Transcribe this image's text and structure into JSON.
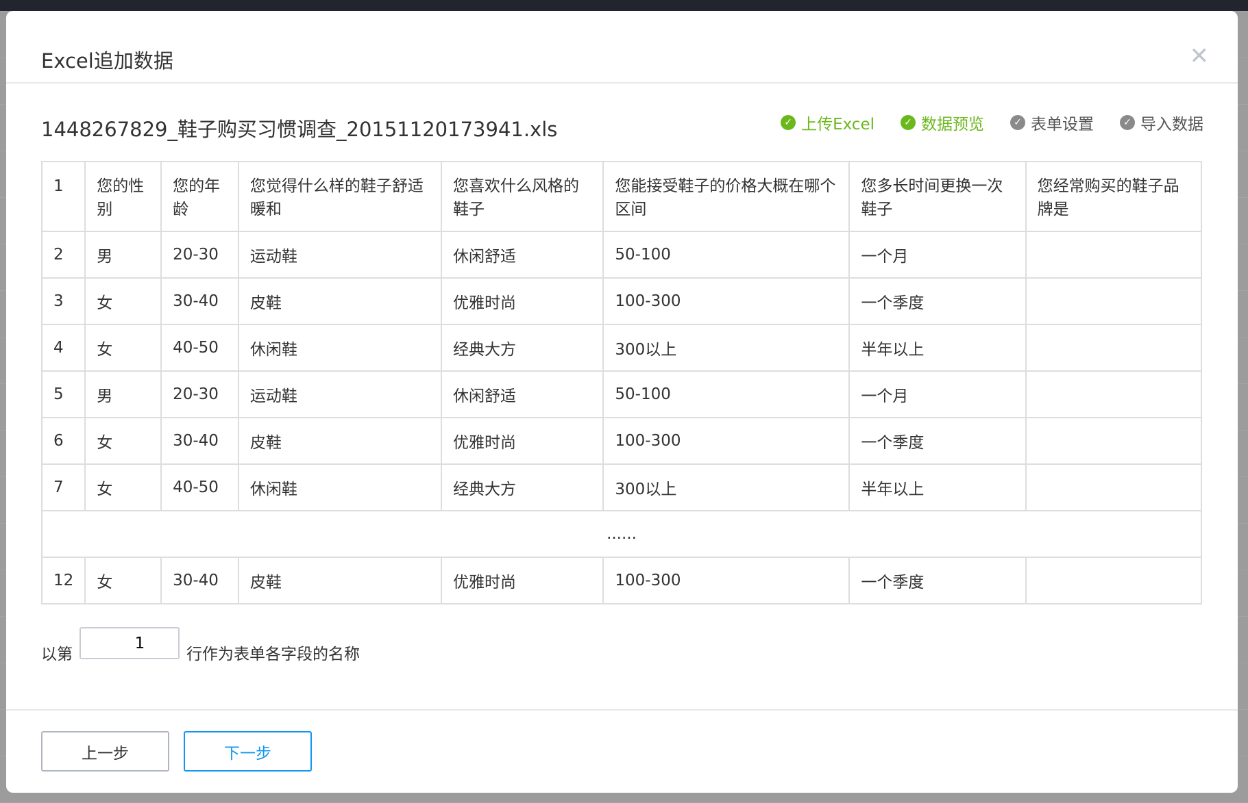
{
  "dialog": {
    "title": "Excel追加数据",
    "close_icon": "close-icon",
    "filename": "1448267829_鞋子购买习惯调查_20151120173941.xls"
  },
  "steps": [
    {
      "label": "上传Excel",
      "status": "done"
    },
    {
      "label": "数据预览",
      "status": "done"
    },
    {
      "label": "表单设置",
      "status": "pending"
    },
    {
      "label": "导入数据",
      "status": "pending"
    }
  ],
  "colors": {
    "done": "#6bb81c",
    "pending": "#8a8a8a",
    "primary": "#1296f0"
  },
  "table": {
    "header": [
      "1",
      "您的性别",
      "您的年龄",
      "您觉得什么样的鞋子舒适暖和",
      "您喜欢什么风格的鞋子",
      "您能接受鞋子的价格大概在哪个区间",
      "您多长时间更换一次鞋子",
      "您经常购买的鞋子品牌是"
    ],
    "rows": [
      [
        "2",
        "男",
        "20-30",
        "运动鞋",
        "休闲舒适",
        "50-100",
        "一个月",
        ""
      ],
      [
        "3",
        "女",
        "30-40",
        "皮鞋",
        "优雅时尚",
        "100-300",
        "一个季度",
        ""
      ],
      [
        "4",
        "女",
        "40-50",
        "休闲鞋",
        "经典大方",
        "300以上",
        "半年以上",
        ""
      ],
      [
        "5",
        "男",
        "20-30",
        "运动鞋",
        "休闲舒适",
        "50-100",
        "一个月",
        ""
      ],
      [
        "6",
        "女",
        "30-40",
        "皮鞋",
        "优雅时尚",
        "100-300",
        "一个季度",
        ""
      ],
      [
        "7",
        "女",
        "40-50",
        "休闲鞋",
        "经典大方",
        "300以上",
        "半年以上",
        ""
      ]
    ],
    "ellipsis": "......",
    "last_row": [
      "12",
      "女",
      "30-40",
      "皮鞋",
      "优雅时尚",
      "100-300",
      "一个季度",
      ""
    ]
  },
  "header_row": {
    "prefix": "以第",
    "value": "1",
    "suffix": "行作为表单各字段的名称"
  },
  "buttons": {
    "prev": "上一步",
    "next": "下一步"
  }
}
